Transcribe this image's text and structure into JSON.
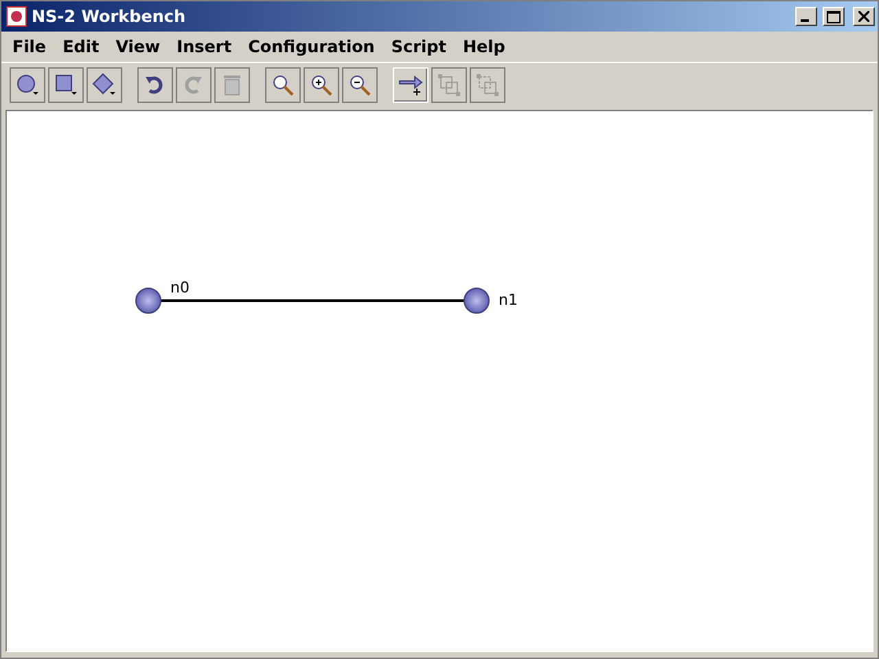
{
  "window": {
    "title": "NS-2 Workbench"
  },
  "menu": [
    "File",
    "Edit",
    "View",
    "Insert",
    "Configuration",
    "Script",
    "Help"
  ],
  "toolbar": [
    [
      {
        "kind": "circle",
        "disabled": false,
        "selected": false
      },
      {
        "kind": "square",
        "disabled": false,
        "selected": false
      },
      {
        "kind": "diamond",
        "disabled": false,
        "selected": false
      }
    ],
    [
      {
        "kind": "undo",
        "disabled": false,
        "selected": false
      },
      {
        "kind": "redo",
        "disabled": true,
        "selected": false
      },
      {
        "kind": "trash",
        "disabled": true,
        "selected": false
      }
    ],
    [
      {
        "kind": "zoom",
        "disabled": false,
        "selected": false
      },
      {
        "kind": "zoom-in",
        "disabled": false,
        "selected": false
      },
      {
        "kind": "zoom-out",
        "disabled": false,
        "selected": false
      }
    ],
    [
      {
        "kind": "link",
        "disabled": false,
        "selected": true
      },
      {
        "kind": "group",
        "disabled": true,
        "selected": false
      },
      {
        "kind": "ungroup",
        "disabled": true,
        "selected": false
      }
    ]
  ],
  "canvas": {
    "nodes": [
      {
        "label": "n0"
      },
      {
        "label": "n1"
      }
    ]
  }
}
